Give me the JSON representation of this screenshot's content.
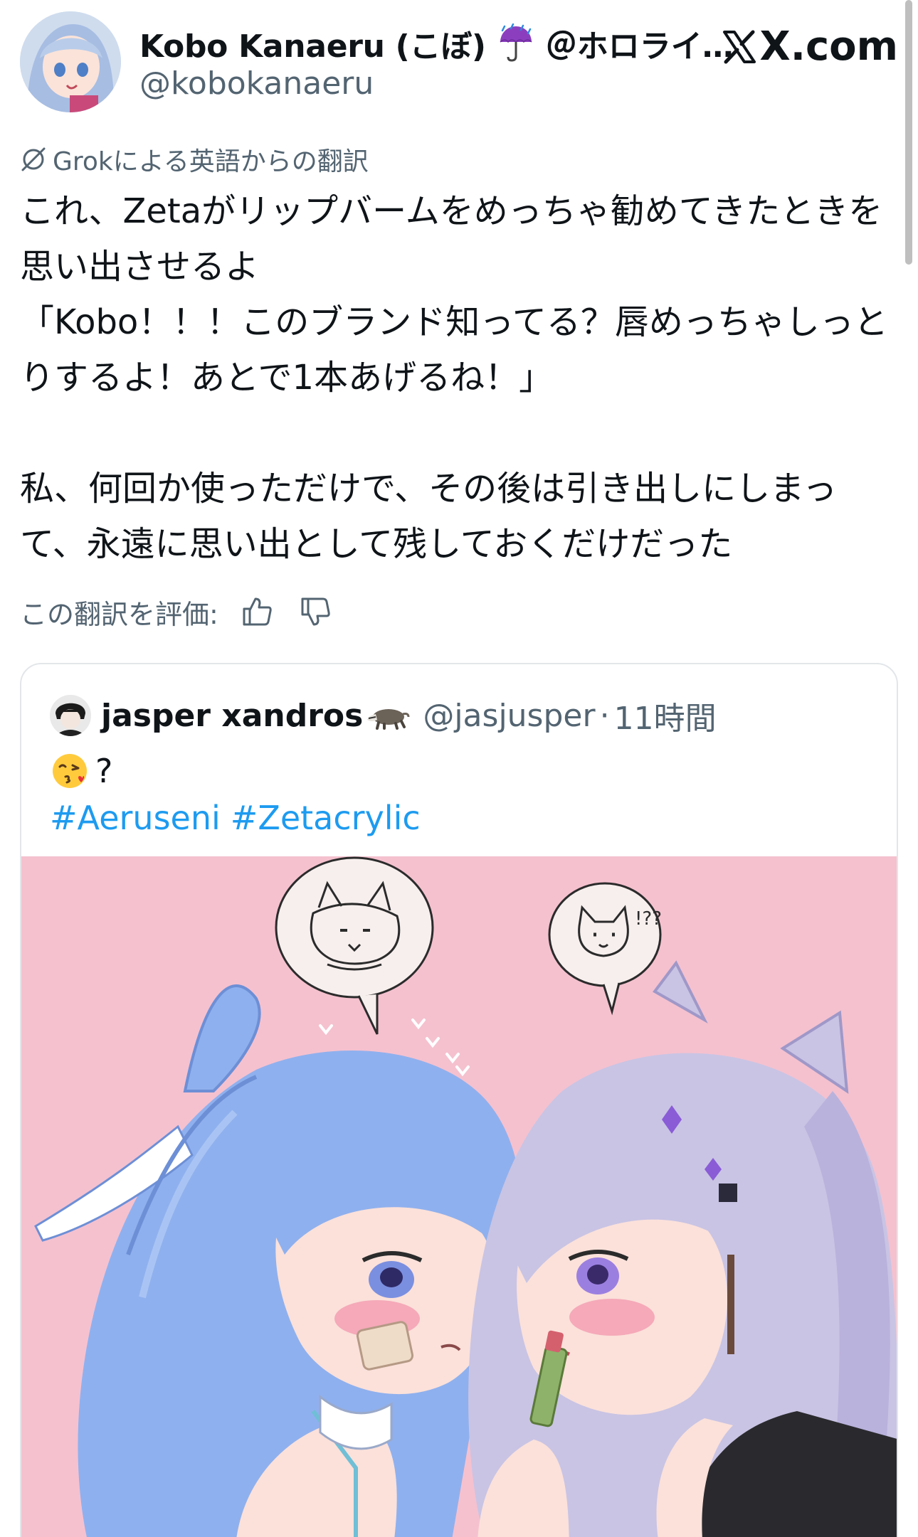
{
  "author": {
    "display_name": "Kobo Kanaeru (こぼ)",
    "affiliation": "＠ホロライ…",
    "handle": "@kobokanaeru",
    "name_emoji": "umbrella-with-rain-icon"
  },
  "site_brand": "X.com",
  "translation": {
    "source_label": "Grokによる英語からの翻訳",
    "icon": "grok-icon",
    "text": "これ、Zetaがリップバームをめっちゃ勧めてきたときを思い出させるよ\n「Kobo！！！このブランド知ってる？唇めっちゃしっとりするよ！あとで1本あげるね！」\n\n私、何回か使っただけで、その後は引き出しにしまって、永遠に思い出として残しておくだけだった",
    "rate_label": "この翻訳を評価:",
    "rate_up_icon": "thumbs-up-icon",
    "rate_down_icon": "thumbs-down-icon"
  },
  "quoted_post": {
    "display_name": "jasper xandros",
    "name_emoji": "badger-icon",
    "handle": "@jasjusper",
    "separator": "·",
    "time": "11時間",
    "body_emoji": "face-blowing-kiss-icon",
    "body_text": "?",
    "hashtags": [
      "#Aeruseni",
      "#Zetacrylic"
    ],
    "image_icon": "illustration-image"
  },
  "colors": {
    "text": "#0f1419",
    "secondary": "#536471",
    "link": "#1d9bf0",
    "border": "#e3e6e9",
    "image_bg": "#f5c1cf"
  }
}
